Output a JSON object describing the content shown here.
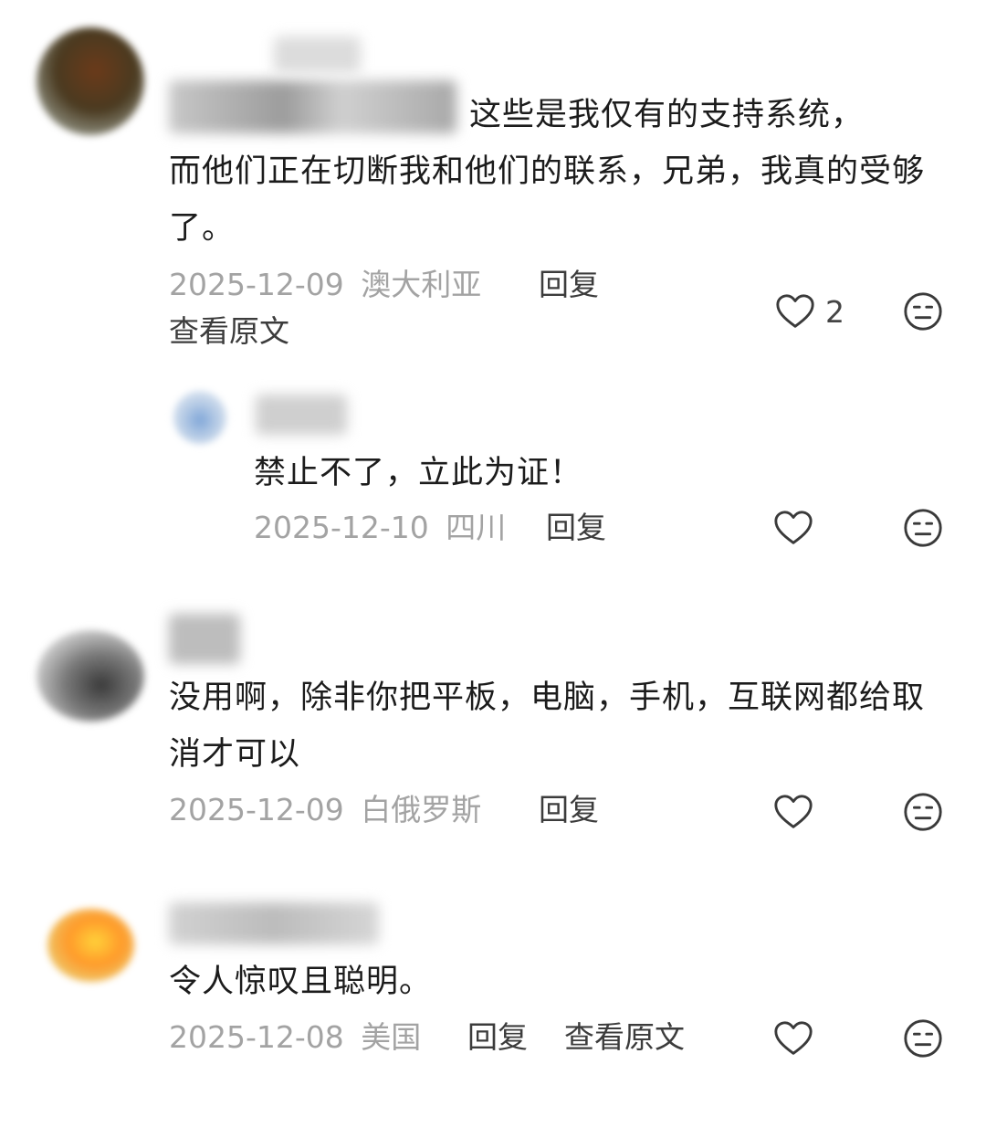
{
  "comments": [
    {
      "text_start": "这些是我仅有的支持系统，",
      "text_rest": "而他们正在切断我和他们的联系，兄弟，我真的受够了。",
      "date": "2025-12-09",
      "location": "澳大利亚",
      "reply_label": "回复",
      "view_original_label": "查看原文",
      "likes": "2",
      "like_icon": "heart-outline-icon",
      "reaction_icon": "meh-face-icon"
    },
    {
      "text": "禁止不了，立此为证！",
      "date": "2025-12-10",
      "location": "四川",
      "reply_label": "回复",
      "like_icon": "heart-outline-icon",
      "reaction_icon": "meh-face-icon"
    },
    {
      "text": "没用啊，除非你把平板，电脑，手机，互联网都给取消才可以",
      "date": "2025-12-09",
      "location": "白俄罗斯",
      "reply_label": "回复",
      "like_icon": "heart-outline-icon",
      "reaction_icon": "meh-face-icon"
    },
    {
      "text": "令人惊叹且聪明。",
      "date": "2025-12-08",
      "location": "美国",
      "reply_label": "回复",
      "view_original_label": "查看原文",
      "like_icon": "heart-outline-icon",
      "reaction_icon": "meh-face-icon"
    }
  ],
  "colors": {
    "text": "#1c1c1c",
    "meta": "#a3a3a3",
    "action": "#3c3c3c"
  }
}
